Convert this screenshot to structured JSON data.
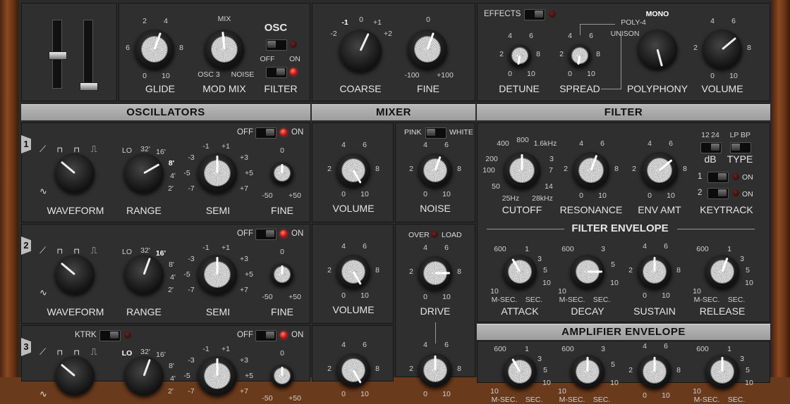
{
  "top": {
    "glide": {
      "label": "GLIDE",
      "ticks": [
        "2",
        "4",
        "6",
        "8",
        "0",
        "10"
      ]
    },
    "modmix": {
      "label": "MOD MIX",
      "mix": "MIX",
      "left": "OSC 3",
      "right": "NOISE"
    },
    "osc_filter": {
      "osc": "OSC",
      "off": "OFF",
      "on": "ON",
      "filter": "FILTER"
    },
    "coarse": {
      "label": "COARSE",
      "ticks": [
        "-1",
        "0",
        "+1",
        "-2",
        "+2"
      ]
    },
    "fine": {
      "label": "FINE",
      "ticks": [
        "0",
        "-100",
        "+100"
      ]
    },
    "effects": {
      "label": "EFFECTS"
    },
    "detune": {
      "label": "DETUNE",
      "ticks": [
        "4",
        "6",
        "2",
        "8",
        "0",
        "10"
      ]
    },
    "spread": {
      "label": "SPREAD",
      "ticks": [
        "4",
        "6",
        "2",
        "8",
        "0",
        "10"
      ]
    },
    "polyphony": {
      "label": "POLYPHONY",
      "options": [
        "MONO",
        "POLY-4",
        "UNISON"
      ]
    },
    "volume": {
      "label": "VOLUME",
      "ticks": [
        "4",
        "6",
        "2",
        "8",
        "0",
        "10"
      ]
    }
  },
  "sections": {
    "oscillators": "OSCILLATORS",
    "mixer": "MIXER",
    "filter": "FILTER",
    "filter_env": "FILTER ENVELOPE",
    "amp_env": "AMPLIFIER ENVELOPE"
  },
  "osc": {
    "off": "OFF",
    "on": "ON",
    "ktrk": "KTRK",
    "waveform": "WAVEFORM",
    "range": "RANGE",
    "semi": "SEMI",
    "fine": "FINE",
    "range_ticks": [
      "LO",
      "32'",
      "16'",
      "8'",
      "4'",
      "2'"
    ],
    "semi_ticks": [
      "-1",
      "+1",
      "-3",
      "+3",
      "-5",
      "+5",
      "-7",
      "+7"
    ],
    "fine_ticks": [
      "0",
      "-50",
      "+50"
    ],
    "numbers": [
      "1",
      "2",
      "3"
    ]
  },
  "mixer": {
    "volume": "VOLUME",
    "noise": "NOISE",
    "drive": "DRIVE",
    "pink": "PINK",
    "white": "WHITE",
    "over": "OVER",
    "load": "LOAD",
    "ticks": [
      "4",
      "6",
      "2",
      "8",
      "0",
      "10"
    ]
  },
  "filter": {
    "cutoff": "CUTOFF",
    "resonance": "RESONANCE",
    "env_amt": "ENV AMT",
    "keytrack": "KEYTRACK",
    "cutoff_ticks": [
      "400",
      "800",
      "1.6kHz",
      "200",
      "3",
      "100",
      "7",
      "50",
      "14",
      "25Hz",
      "28kHz"
    ],
    "db_opts": [
      "12",
      "24"
    ],
    "db": "dB",
    "type_opts": [
      "LP",
      "BP"
    ],
    "type": "TYPE",
    "k1": "1",
    "k2": "2",
    "on": "ON",
    "ticks": [
      "4",
      "6",
      "2",
      "8",
      "0",
      "10"
    ]
  },
  "env": {
    "attack": "ATTACK",
    "decay": "DECAY",
    "sustain": "SUSTAIN",
    "release": "RELEASE",
    "time_ticks": [
      "600",
      "1",
      "3",
      "5",
      "10",
      "10"
    ],
    "msec": "M-SEC.",
    "sec": "SEC.",
    "decay_ticks": [
      "600",
      "3",
      "5",
      "10",
      "10"
    ],
    "sus_ticks": [
      "4",
      "6",
      "2",
      "8",
      "0",
      "10"
    ]
  }
}
